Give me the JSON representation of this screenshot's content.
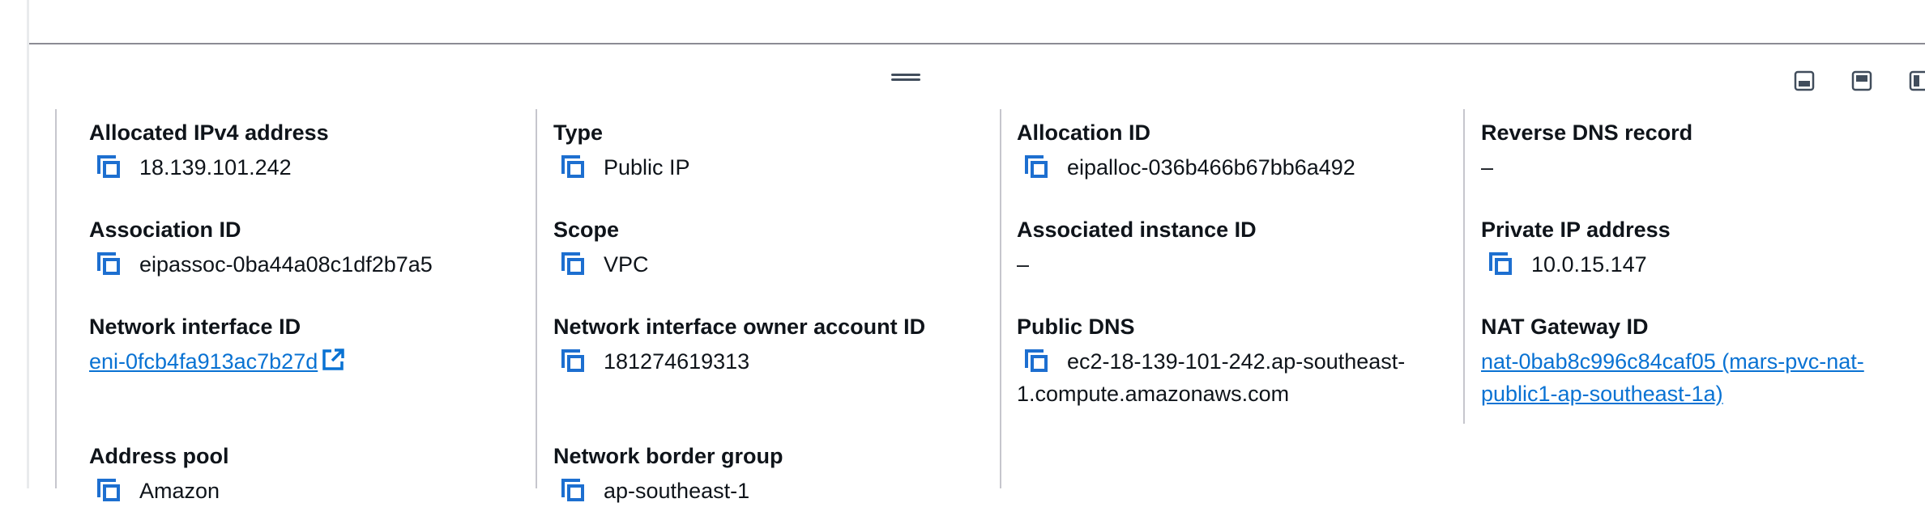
{
  "layout_icons": [
    "bottom-panel-icon",
    "side-panel-icon",
    "split-panel-icon"
  ],
  "fields": {
    "allocated_ipv4": {
      "label": "Allocated IPv4 address",
      "value": "18.139.101.242"
    },
    "type": {
      "label": "Type",
      "value": "Public IP"
    },
    "allocation_id": {
      "label": "Allocation ID",
      "value": "eipalloc-036b466b67bb6a492"
    },
    "reverse_dns": {
      "label": "Reverse DNS record",
      "value": "–"
    },
    "association_id": {
      "label": "Association ID",
      "value": "eipassoc-0ba44a08c1df2b7a5"
    },
    "scope": {
      "label": "Scope",
      "value": "VPC"
    },
    "associated_instance": {
      "label": "Associated instance ID",
      "value": "–"
    },
    "private_ip": {
      "label": "Private IP address",
      "value": "10.0.15.147"
    },
    "network_interface": {
      "label": "Network interface ID",
      "value": "eni-0fcb4fa913ac7b27d"
    },
    "owner_account": {
      "label": "Network interface owner account ID",
      "value": "181274619313"
    },
    "public_dns": {
      "label": "Public DNS",
      "value_line1": "ec2-18-139-101-242.ap-southeast-",
      "value_line2": "1.compute.amazonaws.com"
    },
    "nat_gateway": {
      "label": "NAT Gateway ID",
      "value_line1": "nat-0bab8c996c84caf05 (mars-pvc-nat-",
      "value_line2": "public1-ap-southeast-1a)"
    },
    "address_pool": {
      "label": "Address pool",
      "value": "Amazon"
    },
    "border_group": {
      "label": "Network border group",
      "value": "ap-southeast-1"
    }
  },
  "colors": {
    "accent": "#0972d3",
    "copy_icon": "#1d6fd0",
    "text": "#0f141a"
  }
}
